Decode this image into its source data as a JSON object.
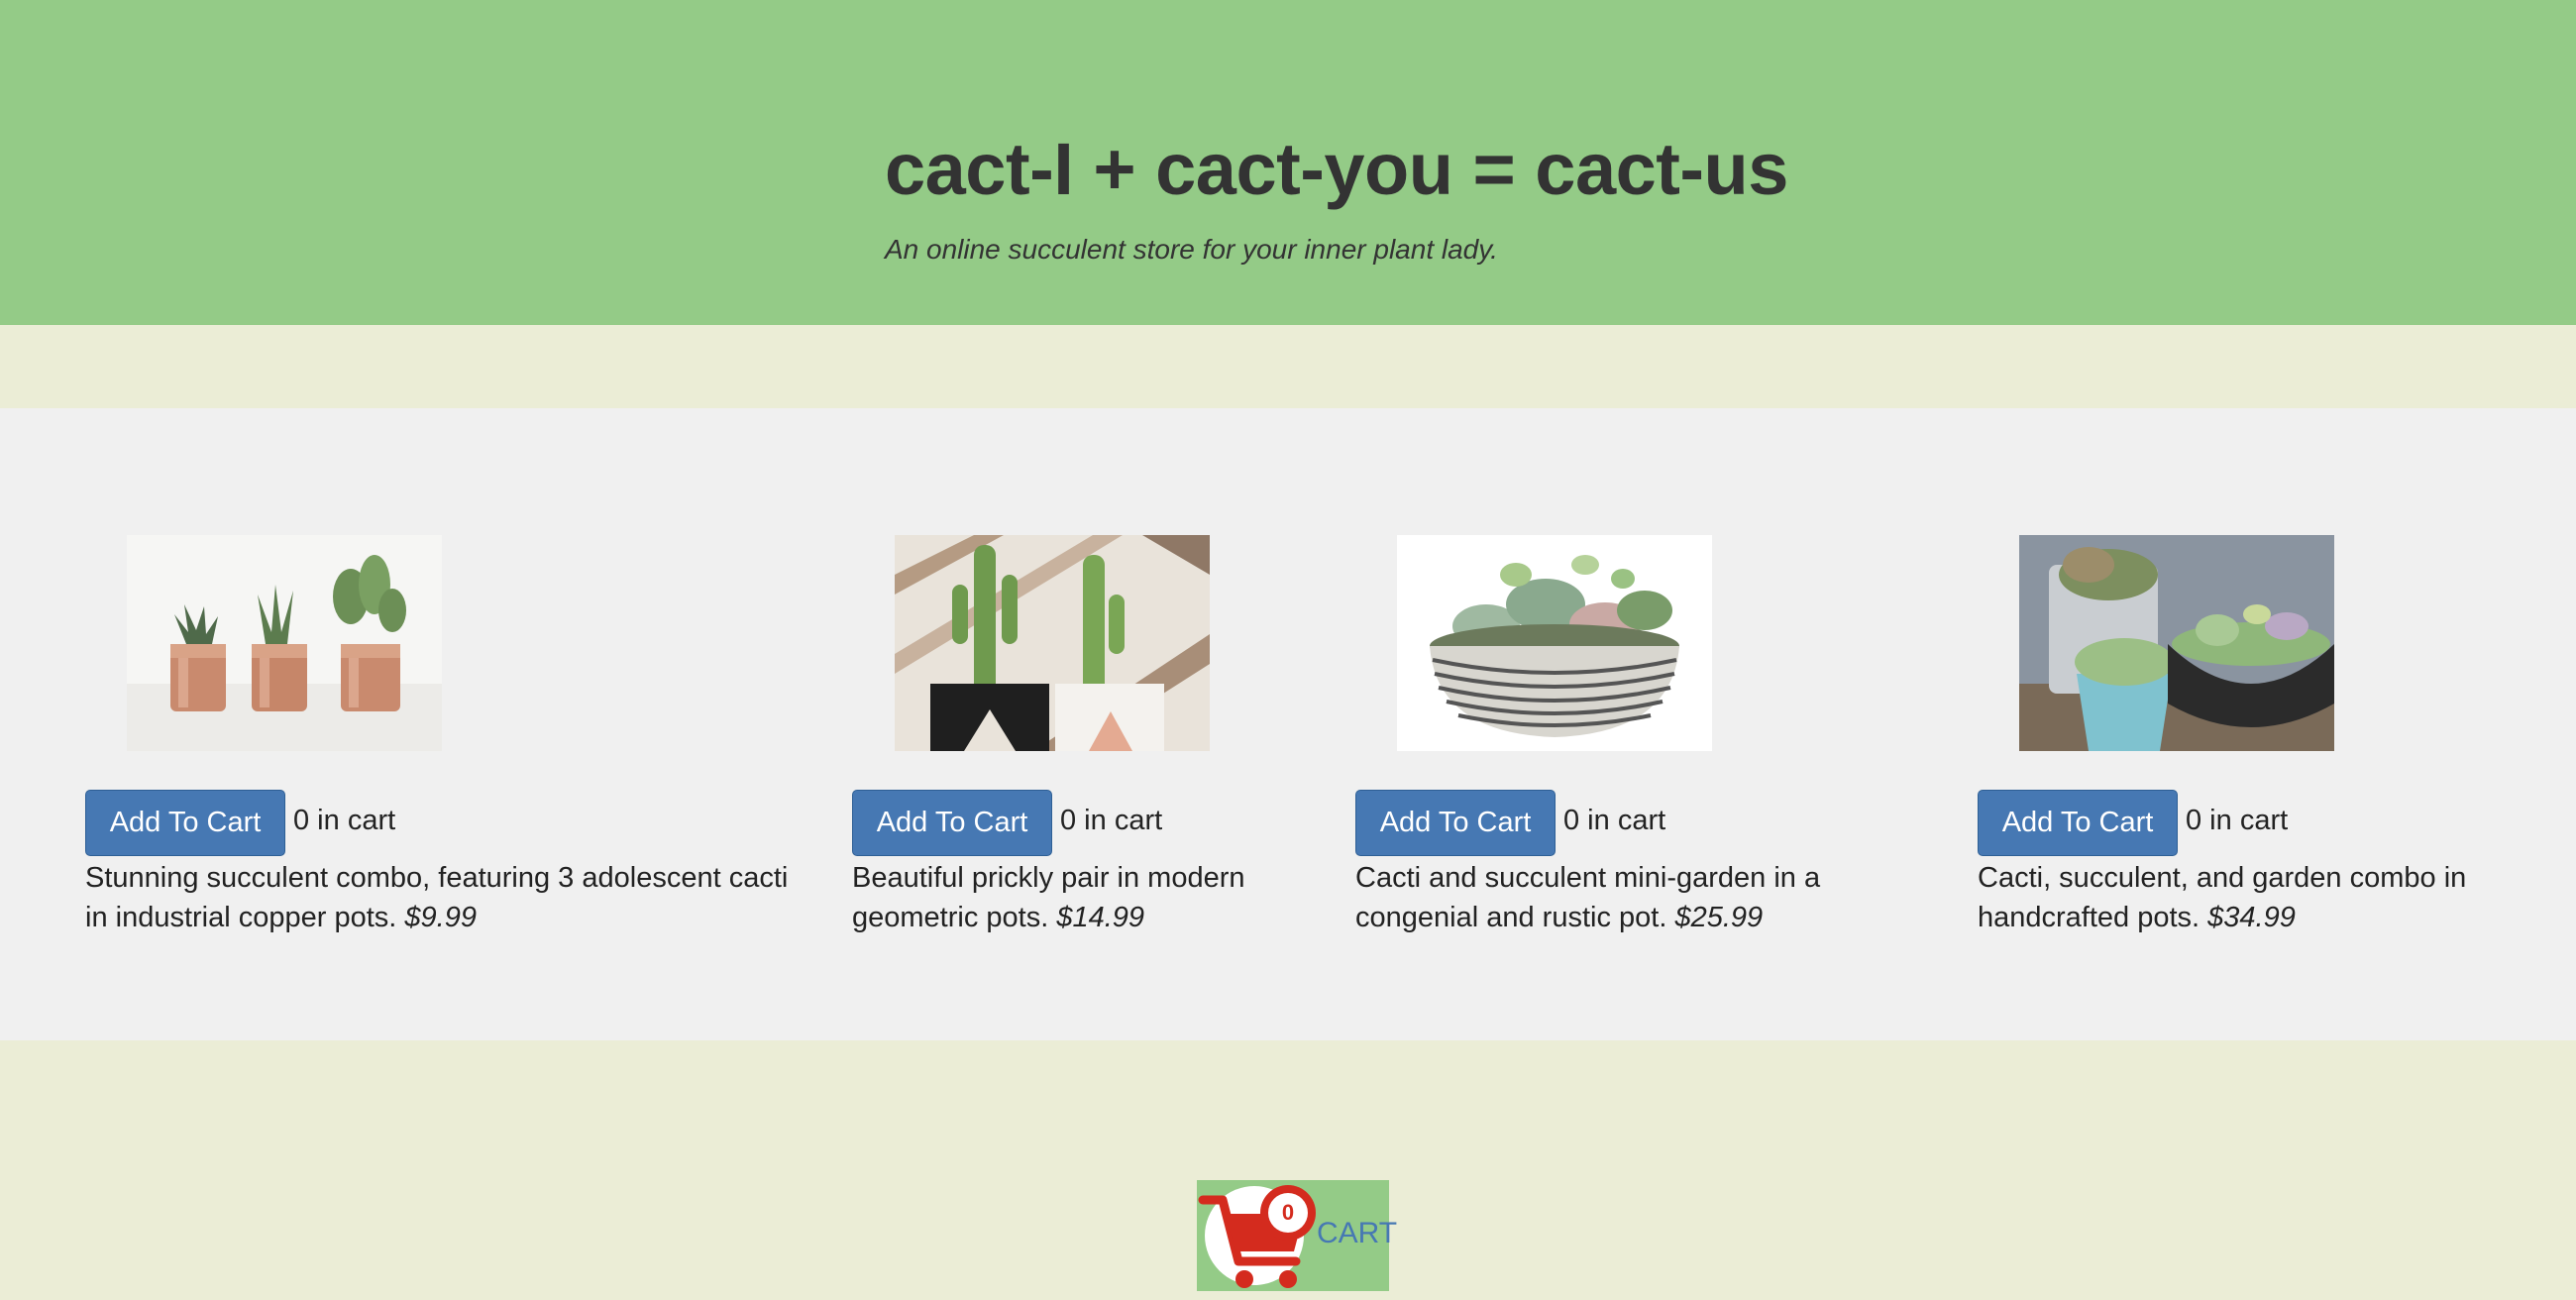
{
  "hero": {
    "title": "cact-I + cact-you = cact-us",
    "subtitle": "An online succulent store for your inner plant lady."
  },
  "products": [
    {
      "button_label": "Add To Cart",
      "qty_text": "0 in cart",
      "description": "Stunning succulent combo, featuring 3 adolescent cacti in industrial copper pots.",
      "price": "$9.99"
    },
    {
      "button_label": "Add To Cart",
      "qty_text": "0 in cart",
      "description": "Beautiful prickly pair in modern geometric pots.",
      "price": "$14.99"
    },
    {
      "button_label": "Add To Cart",
      "qty_text": "0 in cart",
      "description": "Cacti and succulent mini-garden in a congenial and rustic pot.",
      "price": "$25.99"
    },
    {
      "button_label": "Add To Cart",
      "qty_text": "0 in cart",
      "description": "Cacti, succulent, and garden combo in handcrafted pots.",
      "price": "$34.99"
    }
  ],
  "cart": {
    "label": "CART",
    "count": "0",
    "icon": "shopping-cart-icon"
  },
  "colors": {
    "hero_bg": "#94cb87",
    "page_bg": "#ebedd6",
    "products_bg": "#f0f0f0",
    "button_bg": "#4678b3",
    "cart_red": "#d42b1e"
  }
}
